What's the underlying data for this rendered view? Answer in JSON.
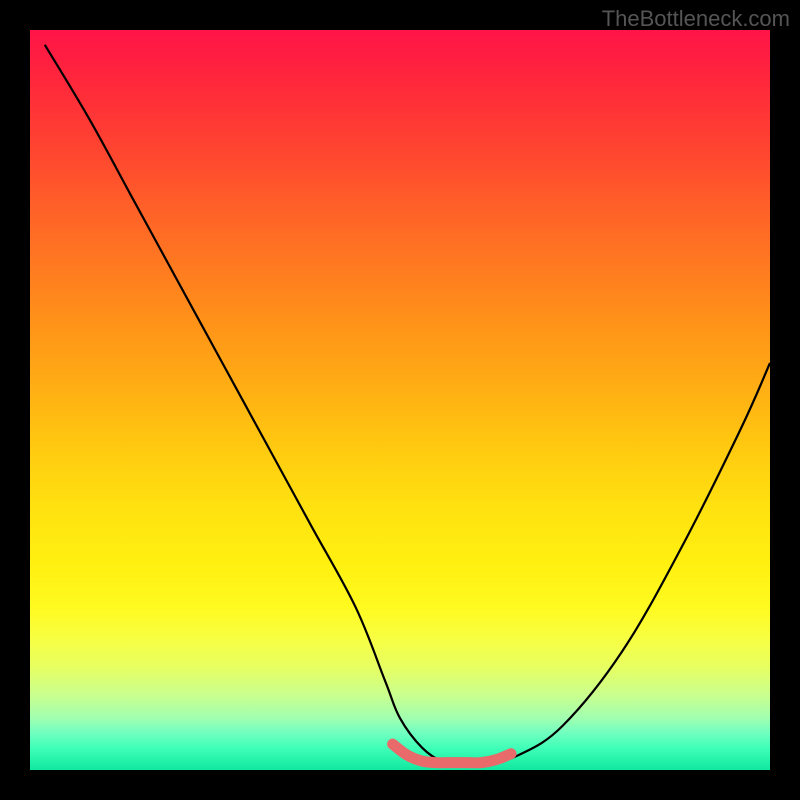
{
  "watermark": "TheBottleneck.com",
  "chart_data": {
    "type": "line",
    "title": "",
    "xlabel": "",
    "ylabel": "",
    "xlim": [
      0,
      100
    ],
    "ylim": [
      0,
      100
    ],
    "grid": false,
    "series": [
      {
        "name": "bottleneck-curve",
        "x": [
          2,
          8,
          14,
          20,
          26,
          32,
          38,
          44,
          48,
          50,
          53,
          56,
          58,
          60,
          62,
          66,
          72,
          80,
          88,
          96,
          100
        ],
        "y": [
          98,
          88,
          77,
          66,
          55,
          44,
          33,
          22,
          12,
          7,
          3,
          1,
          1,
          1,
          1,
          2,
          6,
          16,
          30,
          46,
          55
        ],
        "color": "#000000"
      },
      {
        "name": "highlight-segment",
        "x": [
          49,
          51,
          53,
          55,
          57,
          59,
          61,
          63,
          65
        ],
        "y": [
          3.5,
          2.0,
          1.2,
          1.0,
          1.0,
          1.0,
          1.0,
          1.4,
          2.2
        ],
        "color": "#e86a6a"
      }
    ],
    "gradient_stops": [
      {
        "pos": 0,
        "color": "#ff1448"
      },
      {
        "pos": 50,
        "color": "#ffc810"
      },
      {
        "pos": 80,
        "color": "#fff010"
      },
      {
        "pos": 100,
        "color": "#10e8a0"
      }
    ]
  }
}
